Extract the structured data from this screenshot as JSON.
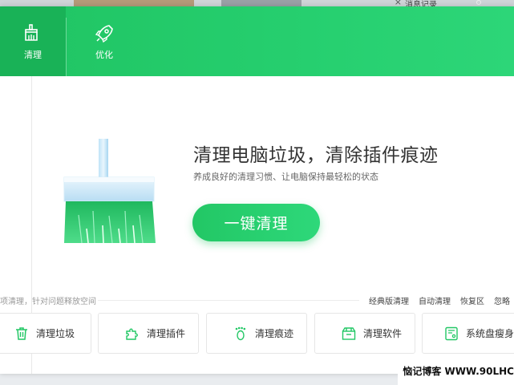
{
  "background": {
    "close_glyph": "×",
    "message_label": "消息记录"
  },
  "tabs": [
    {
      "label": "清理",
      "icon": "broom-icon",
      "active": true
    },
    {
      "label": "优化",
      "icon": "rocket-icon",
      "active": false
    }
  ],
  "hero": {
    "title": "清理电脑垃圾，清除插件痕迹",
    "subtitle": "养成良好的清理习惯、让电脑保持最轻松的状态",
    "button": "一键清理"
  },
  "bottom": {
    "hint": "项清理，针对问题释放空间",
    "links": [
      "经典版清理",
      "自动清理",
      "恢复区",
      "忽略"
    ]
  },
  "tools": [
    {
      "label": "清理垃圾",
      "icon": "trash-icon"
    },
    {
      "label": "清理插件",
      "icon": "puzzle-icon"
    },
    {
      "label": "清理痕迹",
      "icon": "footprint-icon"
    },
    {
      "label": "清理软件",
      "icon": "software-box-icon"
    },
    {
      "label": "系统盘瘦身",
      "icon": "disk-icon"
    }
  ],
  "watermark": "恼记博客 WWW.90LHC",
  "colors": {
    "accent": "#22c765",
    "accent_dark": "#19b257",
    "text": "#333333"
  }
}
